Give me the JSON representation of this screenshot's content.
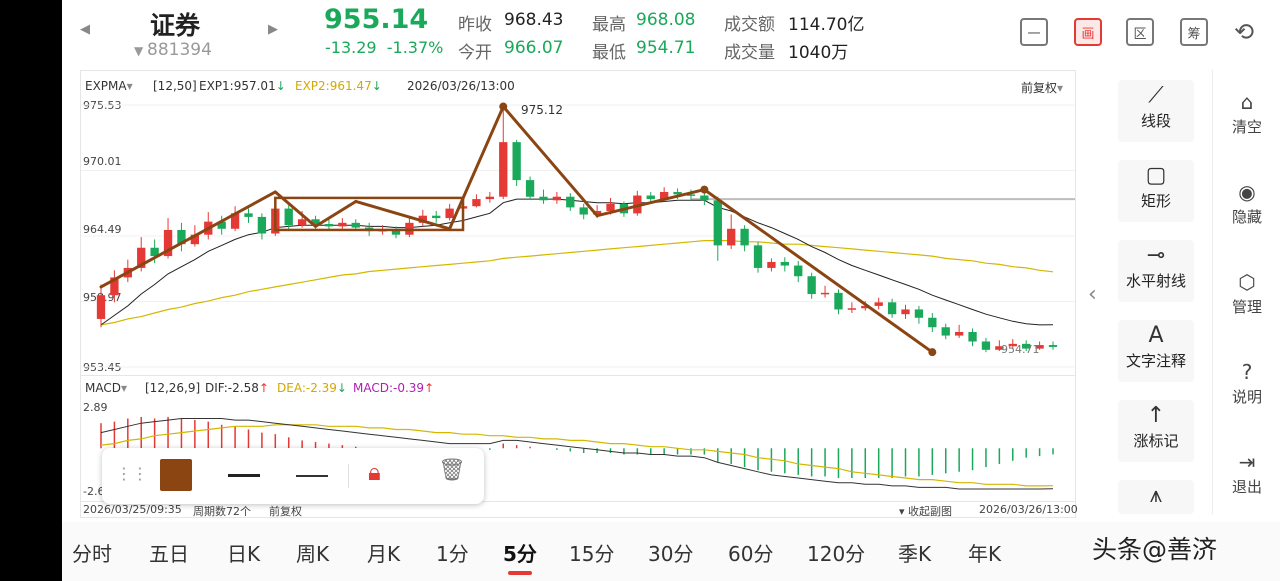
{
  "header": {
    "name": "证券",
    "code": "881394",
    "price": "955.14",
    "change": "-13.29",
    "change_pct": "-1.37%",
    "stats": [
      {
        "label": "昨收",
        "value": "968.43"
      },
      {
        "label": "今开",
        "value": "966.07"
      },
      {
        "label": "最高",
        "value": "968.08"
      },
      {
        "label": "最低",
        "value": "954.71"
      },
      {
        "label": "成交额",
        "value": "114.70亿"
      },
      {
        "label": "成交量",
        "value": "1040万"
      }
    ],
    "top_icons": [
      {
        "name": "minus-icon",
        "glyph": "一"
      },
      {
        "name": "chart-screen-icon",
        "glyph": "画"
      },
      {
        "name": "section-icon",
        "glyph": "区"
      },
      {
        "name": "chips-icon",
        "glyph": "筹"
      },
      {
        "name": "rotate-screen-icon",
        "glyph": "⟲"
      }
    ]
  },
  "indicator_main": {
    "name": "EXPMA",
    "params": "[12,50]",
    "exp1": "EXP1:957.01",
    "exp2": "EXP2:961.47",
    "datetime": "2026/03/26/13:00",
    "adjust": "前复权"
  },
  "axis_main": [
    "975.53",
    "970.01",
    "964.49",
    "958.97",
    "953.45"
  ],
  "peak_label": "975.12",
  "low_label": "954.71",
  "indicator_macd": {
    "name": "MACD",
    "params": "[12,26,9]",
    "dif": "DIF:-2.58",
    "dea": "DEA:-2.39",
    "macd": "MACD:-0.39"
  },
  "axis_macd": [
    "2.89",
    "-2.6"
  ],
  "footer": {
    "start": "2026/03/25/09:35",
    "periods_count": "周期数72个",
    "adjust": "前复权",
    "collapse": "收起副图",
    "end": "2026/03/26/13:00"
  },
  "draw_tools": {
    "color": "#8b4513",
    "items": [
      "grip-icon",
      "color-swatch",
      "line-thick-icon",
      "line-thin-icon",
      "lock-icon",
      "trash-icon"
    ]
  },
  "side_tools": [
    {
      "name": "line-segment",
      "label": "线段",
      "glyph": "⟋"
    },
    {
      "name": "rectangle",
      "label": "矩形",
      "glyph": "▢"
    },
    {
      "name": "horizontal-ray",
      "label": "水平射线",
      "glyph": "⊸"
    },
    {
      "name": "text-note",
      "label": "文字注释",
      "glyph": "A"
    },
    {
      "name": "limit-up-mark",
      "label": "涨标记",
      "glyph": "↑"
    }
  ],
  "side_actions": [
    {
      "name": "clear",
      "label": "清空",
      "glyph": "⌂"
    },
    {
      "name": "hide",
      "label": "隐藏",
      "glyph": "◉"
    },
    {
      "name": "manage",
      "label": "管理",
      "glyph": "⬡"
    },
    {
      "name": "help",
      "label": "说明",
      "glyph": "?"
    },
    {
      "name": "exit",
      "label": "退出",
      "glyph": "⇥"
    }
  ],
  "periods": [
    "分时",
    "五日",
    "日K",
    "周K",
    "月K",
    "1分",
    "5分",
    "15分",
    "30分",
    "60分",
    "120分",
    "季K",
    "年K"
  ],
  "active_period": "5分",
  "watermark": "头条@善济",
  "colors": {
    "up": "#e53935",
    "down": "#1aa85a",
    "draw": "#8b4513",
    "exp1": "#222222",
    "exp2": "#d4b800"
  },
  "chart_data": {
    "type": "candlestick",
    "title": "",
    "ylim": [
      953.45,
      975.53
    ],
    "candles": [
      [
        957.5,
        959.5,
        960.4,
        956.8
      ],
      [
        959.5,
        961.0,
        961.6,
        958.9
      ],
      [
        961.0,
        961.8,
        962.5,
        960.6
      ],
      [
        961.8,
        963.5,
        964.4,
        961.5
      ],
      [
        963.5,
        962.8,
        964.2,
        962.2
      ],
      [
        962.8,
        965.0,
        966.0,
        962.6
      ],
      [
        965.0,
        963.8,
        965.6,
        963.2
      ],
      [
        963.8,
        964.6,
        965.4,
        963.6
      ],
      [
        964.6,
        965.7,
        966.5,
        964.2
      ],
      [
        965.7,
        965.1,
        966.2,
        964.6
      ],
      [
        965.1,
        966.4,
        967.0,
        964.9
      ],
      [
        966.4,
        966.1,
        966.8,
        965.6
      ],
      [
        966.1,
        964.7,
        966.4,
        964.2
      ],
      [
        964.7,
        966.8,
        967.3,
        964.5
      ],
      [
        966.8,
        965.4,
        967.1,
        965.0
      ],
      [
        965.4,
        965.9,
        966.6,
        965.2
      ],
      [
        965.9,
        965.5,
        966.2,
        965.0
      ],
      [
        965.5,
        965.3,
        966.0,
        965.0
      ],
      [
        965.3,
        965.6,
        966.0,
        965.0
      ],
      [
        965.6,
        965.2,
        965.9,
        964.9
      ],
      [
        965.2,
        964.9,
        965.6,
        964.5
      ],
      [
        964.9,
        965.0,
        965.4,
        964.6
      ],
      [
        965.0,
        964.6,
        965.3,
        964.3
      ],
      [
        964.6,
        965.6,
        966.1,
        964.4
      ],
      [
        965.6,
        966.2,
        966.7,
        965.3
      ],
      [
        966.2,
        966.0,
        966.6,
        965.6
      ],
      [
        966.0,
        966.8,
        967.2,
        965.8
      ],
      [
        966.8,
        967.0,
        967.5,
        966.5
      ],
      [
        967.0,
        967.6,
        968.0,
        966.9
      ],
      [
        967.6,
        967.8,
        968.2,
        967.3
      ],
      [
        967.8,
        972.4,
        975.1,
        967.6
      ],
      [
        972.4,
        969.2,
        972.6,
        968.7
      ],
      [
        969.2,
        967.8,
        969.5,
        967.6
      ],
      [
        967.8,
        967.5,
        968.4,
        967.2
      ],
      [
        967.5,
        967.8,
        968.2,
        967.2
      ],
      [
        967.8,
        966.9,
        968.1,
        966.6
      ],
      [
        966.9,
        966.3,
        967.2,
        965.9
      ],
      [
        966.3,
        966.6,
        967.1,
        966.0
      ],
      [
        966.6,
        967.2,
        967.7,
        966.3
      ],
      [
        967.2,
        966.4,
        967.4,
        966.1
      ],
      [
        966.4,
        967.9,
        968.3,
        966.2
      ],
      [
        967.9,
        967.6,
        968.2,
        967.3
      ],
      [
        967.6,
        968.2,
        968.6,
        967.4
      ],
      [
        968.2,
        968.0,
        968.5,
        967.6
      ],
      [
        968.0,
        967.9,
        968.4,
        967.5
      ],
      [
        967.9,
        967.5,
        968.2,
        967.1
      ],
      [
        967.5,
        963.7,
        967.8,
        962.4
      ],
      [
        963.7,
        965.1,
        966.3,
        963.4
      ],
      [
        965.1,
        963.7,
        965.4,
        963.2
      ],
      [
        963.7,
        961.8,
        964.0,
        961.4
      ],
      [
        961.8,
        962.3,
        962.6,
        961.5
      ],
      [
        962.3,
        962.0,
        962.7,
        961.5
      ],
      [
        962.0,
        961.1,
        962.4,
        960.6
      ],
      [
        961.1,
        959.6,
        961.4,
        959.2
      ],
      [
        959.6,
        959.7,
        960.3,
        959.3
      ],
      [
        959.7,
        958.3,
        960.0,
        957.9
      ],
      [
        958.3,
        958.4,
        958.9,
        958.0
      ],
      [
        958.4,
        958.6,
        959.0,
        958.2
      ],
      [
        958.6,
        958.9,
        959.3,
        958.3
      ],
      [
        958.9,
        957.9,
        959.2,
        957.6
      ],
      [
        957.9,
        958.3,
        958.7,
        957.5
      ],
      [
        958.3,
        957.6,
        958.6,
        957.1
      ],
      [
        957.6,
        956.8,
        958.0,
        956.4
      ],
      [
        956.8,
        956.1,
        957.1,
        955.8
      ],
      [
        956.1,
        956.4,
        957.0,
        955.9
      ],
      [
        956.4,
        955.6,
        956.7,
        955.2
      ],
      [
        955.6,
        954.9,
        955.9,
        954.7
      ],
      [
        954.9,
        955.2,
        955.7,
        954.8
      ],
      [
        955.2,
        955.4,
        955.8,
        955.0
      ],
      [
        955.4,
        955.0,
        955.7,
        954.8
      ],
      [
        955.0,
        955.3,
        955.6,
        954.9
      ],
      [
        955.3,
        955.14,
        955.6,
        954.9
      ]
    ],
    "exp1": [
      957.0,
      957.8,
      958.6,
      959.6,
      960.4,
      961.3,
      961.9,
      962.5,
      963.2,
      963.7,
      964.2,
      964.6,
      964.8,
      965.2,
      965.3,
      965.4,
      965.4,
      965.4,
      965.4,
      965.4,
      965.3,
      965.3,
      965.2,
      965.2,
      965.3,
      965.4,
      965.6,
      965.8,
      966.1,
      966.4,
      967.3,
      967.6,
      967.6,
      967.6,
      967.6,
      967.5,
      967.4,
      967.3,
      967.3,
      967.2,
      967.3,
      967.3,
      967.4,
      967.5,
      967.5,
      967.5,
      966.9,
      966.6,
      966.1,
      965.6,
      965.2,
      964.7,
      964.2,
      963.6,
      963.1,
      962.5,
      962.0,
      961.6,
      961.2,
      960.8,
      960.4,
      960.0,
      959.5,
      959.1,
      958.7,
      958.3,
      957.9,
      957.6,
      957.3,
      957.1,
      957.0,
      957.01
    ],
    "exp2": [
      957.0,
      957.2,
      957.5,
      957.7,
      958.0,
      958.3,
      958.5,
      958.8,
      959.0,
      959.3,
      959.5,
      959.8,
      960.0,
      960.2,
      960.4,
      960.6,
      960.8,
      961.0,
      961.2,
      961.3,
      961.5,
      961.6,
      961.7,
      961.8,
      961.9,
      962.0,
      962.1,
      962.2,
      962.3,
      962.4,
      962.6,
      962.7,
      962.8,
      962.9,
      963.0,
      963.1,
      963.2,
      963.3,
      963.4,
      963.5,
      963.6,
      963.7,
      963.8,
      963.9,
      964.0,
      964.1,
      964.1,
      964.1,
      964.0,
      964.0,
      963.9,
      963.8,
      963.8,
      963.7,
      963.6,
      963.5,
      963.4,
      963.3,
      963.2,
      963.1,
      963.0,
      962.9,
      962.8,
      962.6,
      962.5,
      962.4,
      962.2,
      962.1,
      961.9,
      961.8,
      961.6,
      961.47
    ],
    "macd_hist": [
      1.6,
      1.7,
      1.9,
      2.0,
      1.9,
      2.0,
      1.9,
      1.8,
      1.7,
      1.5,
      1.4,
      1.2,
      1.0,
      0.9,
      0.7,
      0.5,
      0.4,
      0.3,
      0.2,
      0.1,
      0.0,
      -0.1,
      -0.1,
      -0.2,
      -0.2,
      -0.2,
      -0.2,
      -0.2,
      -0.1,
      -0.1,
      0.3,
      0.2,
      0.1,
      0.0,
      -0.1,
      -0.2,
      -0.3,
      -0.3,
      -0.3,
      -0.4,
      -0.4,
      -0.4,
      -0.4,
      -0.4,
      -0.4,
      -0.4,
      -0.9,
      -1.0,
      -1.2,
      -1.4,
      -1.5,
      -1.6,
      -1.7,
      -1.8,
      -1.8,
      -1.9,
      -1.9,
      -1.9,
      -1.9,
      -1.9,
      -1.8,
      -1.8,
      -1.7,
      -1.6,
      -1.5,
      -1.4,
      -1.2,
      -1.0,
      -0.8,
      -0.6,
      -0.5,
      -0.39
    ],
    "dif": [
      1.0,
      1.2,
      1.4,
      1.6,
      1.7,
      1.8,
      1.9,
      1.9,
      1.9,
      1.9,
      1.8,
      1.8,
      1.7,
      1.6,
      1.5,
      1.4,
      1.3,
      1.2,
      1.1,
      1.0,
      0.9,
      0.8,
      0.7,
      0.6,
      0.5,
      0.4,
      0.3,
      0.3,
      0.3,
      0.3,
      0.5,
      0.5,
      0.4,
      0.3,
      0.2,
      0.1,
      0.0,
      -0.1,
      -0.2,
      -0.3,
      -0.3,
      -0.4,
      -0.4,
      -0.5,
      -0.5,
      -0.6,
      -0.9,
      -1.1,
      -1.3,
      -1.5,
      -1.7,
      -1.8,
      -1.9,
      -2.0,
      -2.1,
      -2.2,
      -2.2,
      -2.3,
      -2.3,
      -2.4,
      -2.4,
      -2.5,
      -2.5,
      -2.5,
      -2.6,
      -2.6,
      -2.6,
      -2.6,
      -2.6,
      -2.6,
      -2.6,
      -2.58
    ],
    "dea": [
      0.2,
      0.3,
      0.5,
      0.6,
      0.8,
      0.9,
      1.0,
      1.1,
      1.2,
      1.3,
      1.4,
      1.4,
      1.4,
      1.5,
      1.5,
      1.5,
      1.5,
      1.4,
      1.4,
      1.4,
      1.3,
      1.3,
      1.2,
      1.2,
      1.1,
      1.0,
      1.0,
      0.9,
      0.9,
      0.8,
      0.8,
      0.7,
      0.7,
      0.6,
      0.6,
      0.5,
      0.5,
      0.4,
      0.3,
      0.3,
      0.2,
      0.1,
      0.1,
      0.0,
      -0.1,
      -0.1,
      -0.2,
      -0.3,
      -0.4,
      -0.6,
      -0.7,
      -0.8,
      -1.0,
      -1.1,
      -1.2,
      -1.3,
      -1.5,
      -1.6,
      -1.7,
      -1.8,
      -1.9,
      -2.0,
      -2.0,
      -2.1,
      -2.2,
      -2.2,
      -2.3,
      -2.3,
      -2.3,
      -2.4,
      -2.4,
      -2.39
    ],
    "macd_ylim": [
      -2.6,
      2.89
    ]
  }
}
